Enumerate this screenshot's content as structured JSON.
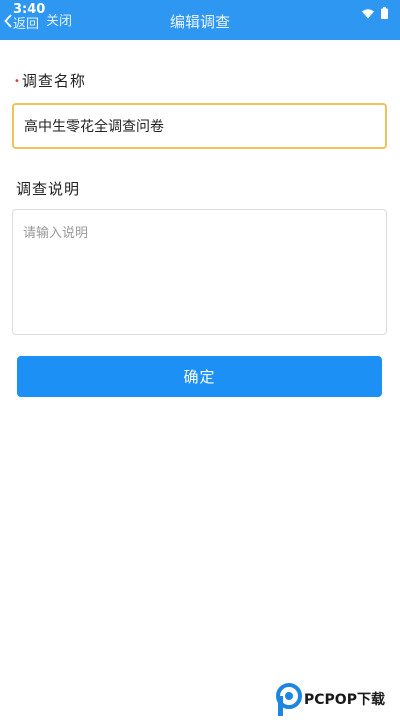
{
  "status_bar": {
    "time": "3:40"
  },
  "nav": {
    "back_label": "返回",
    "close_label": "关闭",
    "title": "编辑调查"
  },
  "form": {
    "name_label": "调查名称",
    "required_marker": "•",
    "name_value": "高中生零花全调查问卷",
    "desc_label": "调查说明",
    "desc_placeholder": "请输入说明",
    "confirm_label": "确定"
  },
  "watermark": {
    "text": "PCPOP下载"
  },
  "colors": {
    "header": "#2d97f2",
    "button": "#1d90f5",
    "focus_border": "#f2c15c",
    "required": "#e23b2e"
  }
}
